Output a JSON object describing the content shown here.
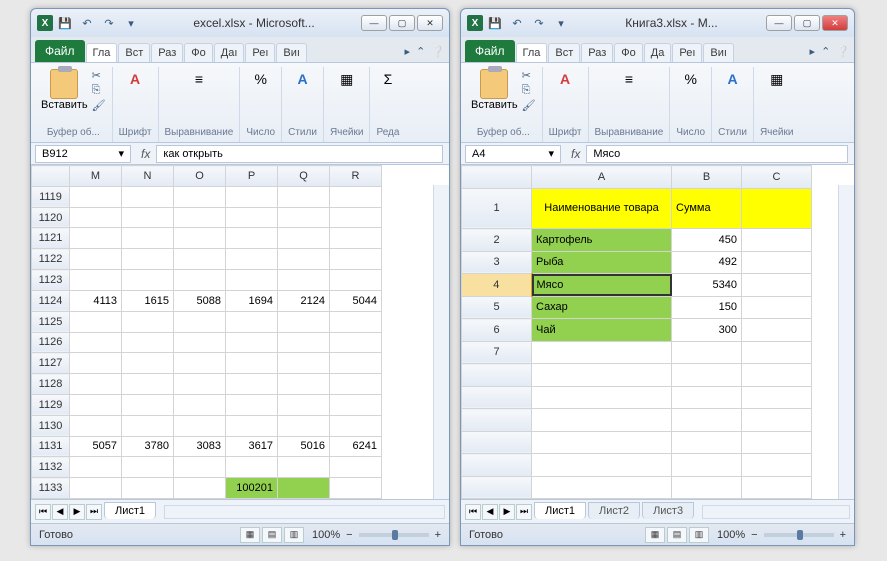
{
  "left": {
    "title": "excel.xlsx - Microsoft...",
    "file_tab": "Файл",
    "tabs": [
      "Гла",
      "Вст",
      "Раз",
      "Фо",
      "Даı",
      "Реı",
      "Виı"
    ],
    "ribbon": {
      "paste": "Вставить",
      "clipboard_label": "Буфер об...",
      "font": "Шрифт",
      "align": "Выравнивание",
      "number": "Число",
      "styles": "Стили",
      "cells": "Ячейки",
      "edit": "Реда"
    },
    "namebox": "B912",
    "formula": "как открыть",
    "cols": [
      "M",
      "N",
      "O",
      "P",
      "Q",
      "R"
    ],
    "rows": [
      "1119",
      "1120",
      "1121",
      "1122",
      "1123",
      "1124",
      "1125",
      "1126",
      "1127",
      "1128",
      "1129",
      "1130",
      "1131",
      "1132",
      "1133"
    ],
    "row1124": [
      "4113",
      "1615",
      "5088",
      "1694",
      "2124",
      "5044"
    ],
    "row1131": [
      "5057",
      "3780",
      "3083",
      "3617",
      "5016",
      "6241"
    ],
    "greenpeek": "100201",
    "sheet": "Лист1",
    "status": "Готово",
    "zoom": "100%"
  },
  "right": {
    "title": "Книга3.xlsx - M...",
    "file_tab": "Файл",
    "tabs": [
      "Гла",
      "Вст",
      "Раз",
      "Фо",
      "Да",
      "Реı",
      "Виı"
    ],
    "ribbon": {
      "paste": "Вставить",
      "clipboard_label": "Буфер об...",
      "font": "Шрифт",
      "align": "Выравнивание",
      "number": "Число",
      "styles": "Стили",
      "cells": "Ячейки"
    },
    "namebox": "A4",
    "formula": "Мясо",
    "cols": [
      "A",
      "B",
      "C"
    ],
    "rows": [
      "1",
      "2",
      "3",
      "4",
      "5",
      "6",
      "7"
    ],
    "header1": "Наименование товара",
    "header2": "Сумма",
    "r2": {
      "a": "Картофель",
      "b": "450"
    },
    "r3": {
      "a": "Рыба",
      "b": "492"
    },
    "r4": {
      "a": "Мясо",
      "b": "5340"
    },
    "r5": {
      "a": "Сахар",
      "b": "150"
    },
    "r6": {
      "a": "Чай",
      "b": "300"
    },
    "sheets": [
      "Лист1",
      "Лист2",
      "Лист3"
    ],
    "status": "Готово",
    "zoom": "100%"
  },
  "chart_data": {
    "type": "table",
    "title": "Книга3 - Лист1",
    "columns": [
      "Наименование товара",
      "Сумма"
    ],
    "rows": [
      [
        "Картофель",
        450
      ],
      [
        "Рыба",
        492
      ],
      [
        "Мясо",
        5340
      ],
      [
        "Сахар",
        150
      ],
      [
        "Чай",
        300
      ]
    ]
  }
}
